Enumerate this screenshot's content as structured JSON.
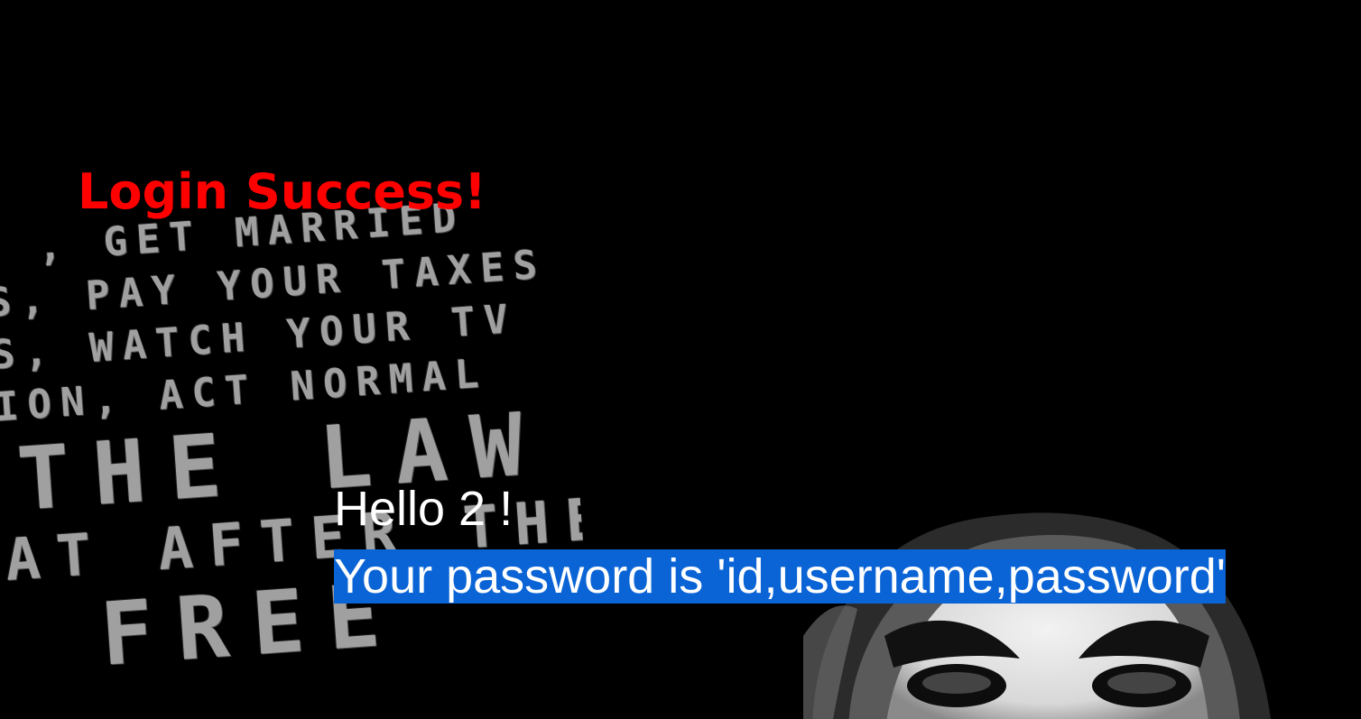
{
  "page": {
    "title": "Login Success!",
    "greeting": "Hello 2 !",
    "password_message": "Your password is 'id,username,password'",
    "password_message_tail": "'"
  },
  "background": {
    "poster_lines": [
      ", GET MARRIED",
      "S, PAY YOUR TAXES",
      "S, WATCH YOUR TV",
      "ION, ACT NORMAL",
      "THE LAW",
      "AT AFTER THE",
      "FREE"
    ]
  },
  "colors": {
    "background": "#000000",
    "title": "#ff0000",
    "text": "#ffffff",
    "selection": "#0a64d6"
  }
}
